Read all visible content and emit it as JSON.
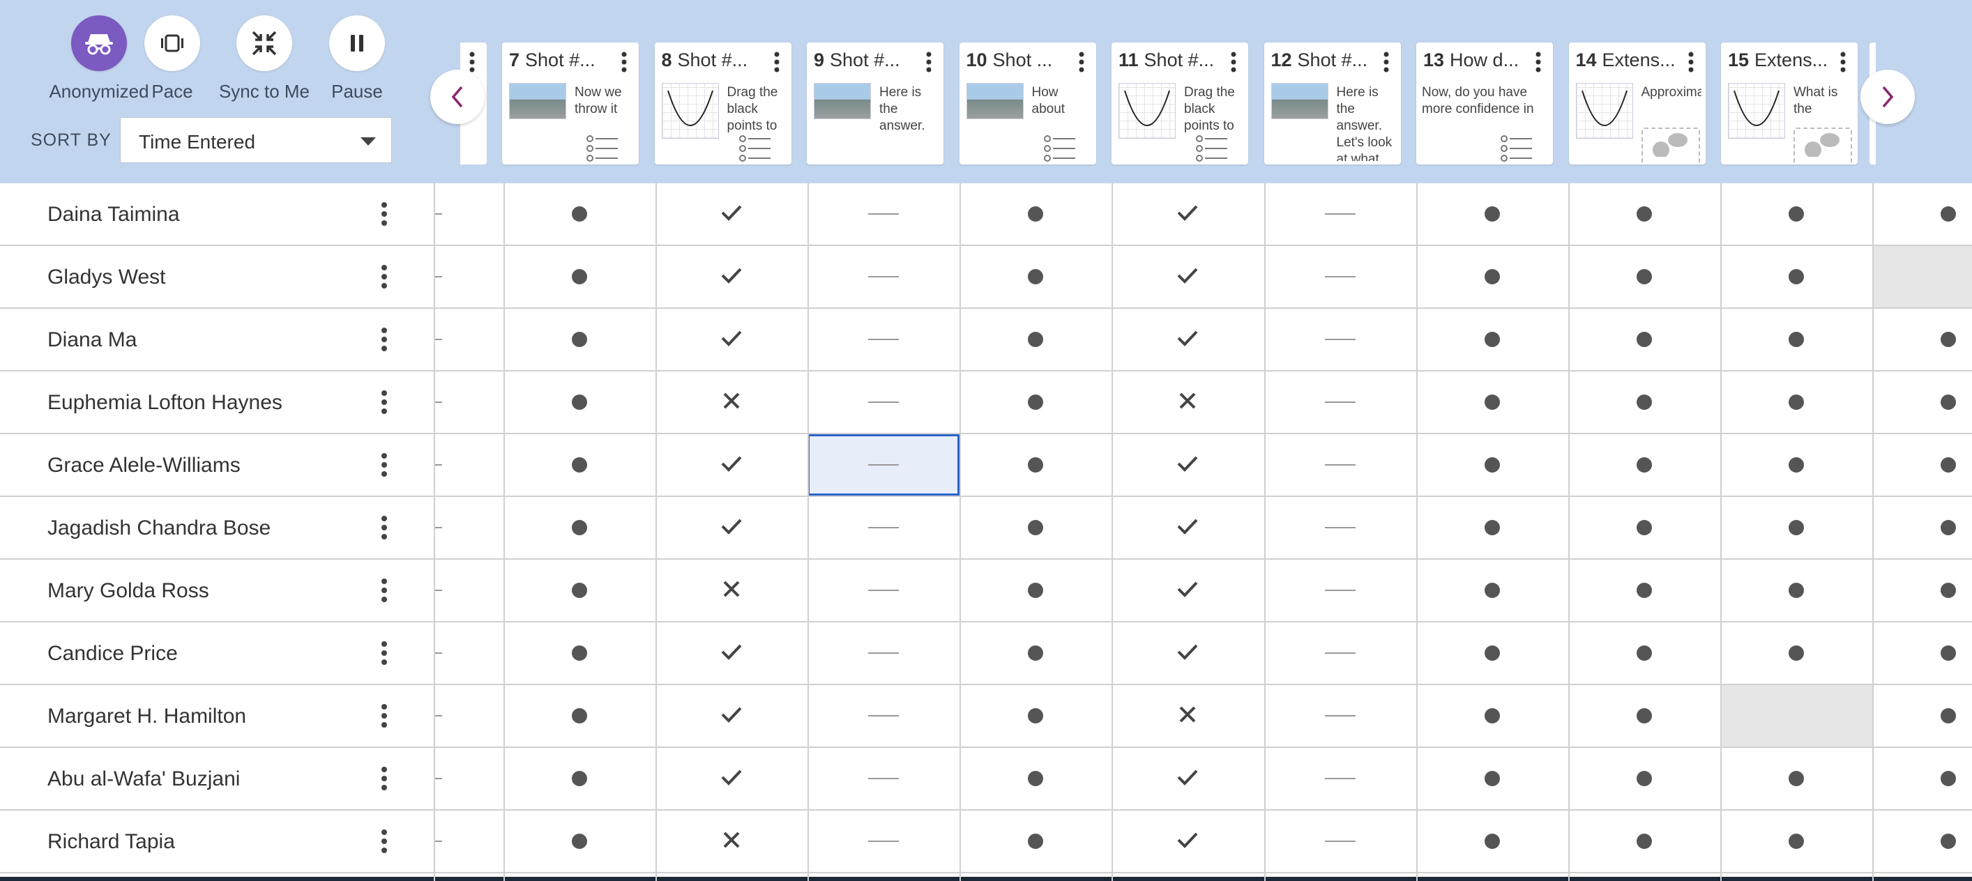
{
  "controls": [
    {
      "label": "Anonymized",
      "icon": "incognito-icon",
      "active": true
    },
    {
      "label": "Pace",
      "icon": "pace-icon",
      "active": false
    },
    {
      "label": "Sync to Me",
      "icon": "sync-collapse-icon",
      "active": false
    },
    {
      "label": "Pause",
      "icon": "pause-icon",
      "active": false
    }
  ],
  "sort": {
    "label": "SORT BY",
    "value": "Time Entered"
  },
  "cards": [
    {
      "num": "7",
      "title": "Shot #...",
      "text": "Now we throw it",
      "thumb": "photo",
      "extra": "list"
    },
    {
      "num": "8",
      "title": "Shot #...",
      "text": "Drag the black points to",
      "thumb": "graph",
      "extra": "list"
    },
    {
      "num": "9",
      "title": "Shot #...",
      "text": "Here is the answer.",
      "thumb": "photo",
      "extra": "none"
    },
    {
      "num": "10",
      "title": "Shot ...",
      "text": "How about",
      "thumb": "photo",
      "extra": "list"
    },
    {
      "num": "11",
      "title": "Shot #...",
      "text": "Drag the black points to",
      "thumb": "graph",
      "extra": "list"
    },
    {
      "num": "12",
      "title": "Shot #...",
      "text": "Here is the answer. Let's look at what",
      "thumb": "photo",
      "extra": "none"
    },
    {
      "num": "13",
      "title": "How d...",
      "text": "Now, do you have more confidence in",
      "thumb": "none",
      "extra": "list"
    },
    {
      "num": "14",
      "title": "Extens...",
      "text": "Approximately",
      "thumb": "graph",
      "extra": "chat"
    },
    {
      "num": "15",
      "title": "Extens...",
      "text": "What is the",
      "thumb": "graph",
      "extra": "chat"
    }
  ],
  "students": [
    {
      "name": "Daina Taimina",
      "cells": [
        "dot",
        "check",
        "dash",
        "dot",
        "check",
        "dash",
        "dot",
        "dot",
        "dot",
        "dot"
      ]
    },
    {
      "name": "Gladys West",
      "cells": [
        "dot",
        "check",
        "dash",
        "dot",
        "check",
        "dash",
        "dot",
        "dot",
        "dot",
        "gray"
      ]
    },
    {
      "name": "Diana Ma",
      "cells": [
        "dot",
        "check",
        "dash",
        "dot",
        "check",
        "dash",
        "dot",
        "dot",
        "dot",
        "dot"
      ]
    },
    {
      "name": "Euphemia Lofton Haynes",
      "cells": [
        "dot",
        "x",
        "dash",
        "dot",
        "x",
        "dash",
        "dot",
        "dot",
        "dot",
        "dot"
      ]
    },
    {
      "name": "Grace Alele-Williams",
      "cells": [
        "dot",
        "check",
        "sel",
        "dot",
        "check",
        "dash",
        "dot",
        "dot",
        "dot",
        "dot"
      ]
    },
    {
      "name": "Jagadish Chandra Bose",
      "cells": [
        "dot",
        "check",
        "dash",
        "dot",
        "check",
        "dash",
        "dot",
        "dot",
        "dot",
        "dot"
      ]
    },
    {
      "name": "Mary Golda Ross",
      "cells": [
        "dot",
        "x",
        "dash",
        "dot",
        "check",
        "dash",
        "dot",
        "dot",
        "dot",
        "dot"
      ]
    },
    {
      "name": "Candice Price",
      "cells": [
        "dot",
        "check",
        "dash",
        "dot",
        "check",
        "dash",
        "dot",
        "dot",
        "dot",
        "dot"
      ]
    },
    {
      "name": "Margaret H. Hamilton",
      "cells": [
        "dot",
        "check",
        "dash",
        "dot",
        "x",
        "dash",
        "dot",
        "dot",
        "gray",
        "dot"
      ]
    },
    {
      "name": "Abu al-Wafa' Buzjani",
      "cells": [
        "dot",
        "check",
        "dash",
        "dot",
        "check",
        "dash",
        "dot",
        "dot",
        "dot",
        "dot"
      ]
    },
    {
      "name": "Richard Tapia",
      "cells": [
        "dot",
        "x",
        "dash",
        "dot",
        "check",
        "dash",
        "dot",
        "dot",
        "dot",
        "dot"
      ]
    }
  ]
}
